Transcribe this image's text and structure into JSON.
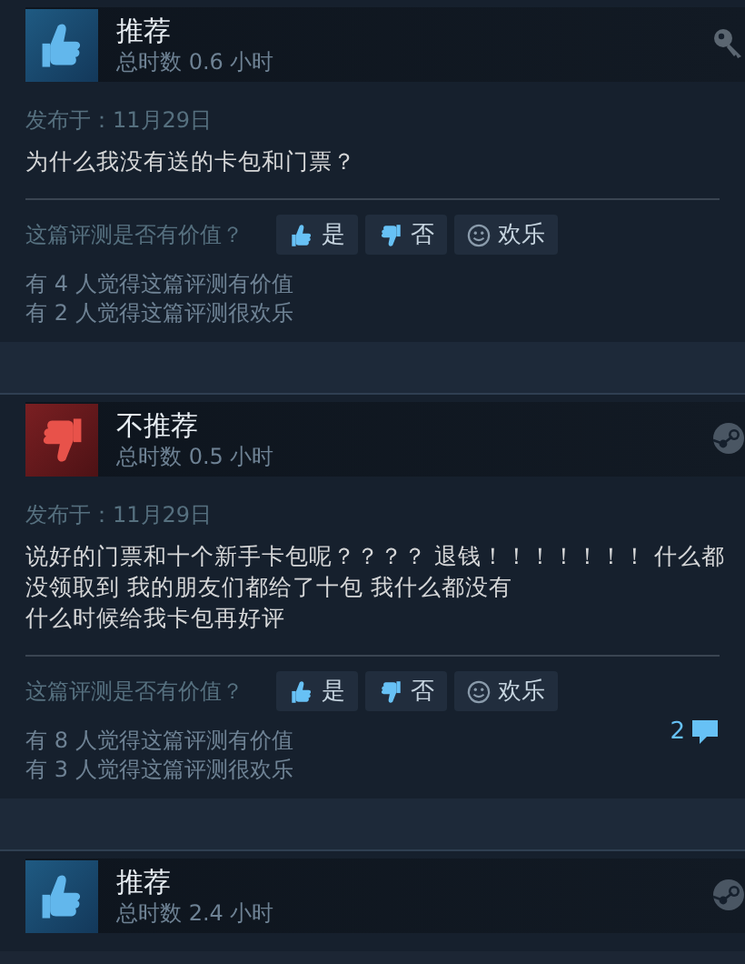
{
  "reviews": [
    {
      "recommended": true,
      "title": "推荐",
      "hours": "总时数 0.6 小时",
      "source": {
        "kind": "key"
      },
      "date": "发布于：11月29日",
      "lines": [
        "为什么我没有送的卡包和门票？"
      ],
      "question": "这篇评测是否有价值？",
      "buttons": [
        {
          "kind": "yes",
          "label": "是"
        },
        {
          "kind": "no",
          "label": "否"
        },
        {
          "kind": "funny",
          "label": "欢乐"
        }
      ],
      "counts": [
        "有 4 人觉得这篇评测有价值",
        "有 2 人觉得这篇评测很欢乐"
      ]
    },
    {
      "recommended": false,
      "title": "不推荐",
      "hours": "总时数 0.5 小时",
      "source": {
        "kind": "steam"
      },
      "date": "发布于：11月29日",
      "lines": [
        "说好的门票和十个新手卡包呢？？？？ 退钱！！！！！！！ 什么都",
        "没领取到 我的朋友们都给了十包 我什么都没有",
        "什么时候给我卡包再好评"
      ],
      "question": "这篇评测是否有价值？",
      "buttons": [
        {
          "kind": "yes",
          "label": "是"
        },
        {
          "kind": "no",
          "label": "否"
        },
        {
          "kind": "funny",
          "label": "欢乐"
        }
      ],
      "counts": [
        "有 8 人觉得这篇评测有价值",
        "有 3 人觉得这篇评测很欢乐"
      ],
      "comments": "2"
    },
    {
      "recommended": true,
      "title": "推荐",
      "hours": "总时数 2.4 小时",
      "source": {
        "kind": "steam"
      }
    }
  ]
}
